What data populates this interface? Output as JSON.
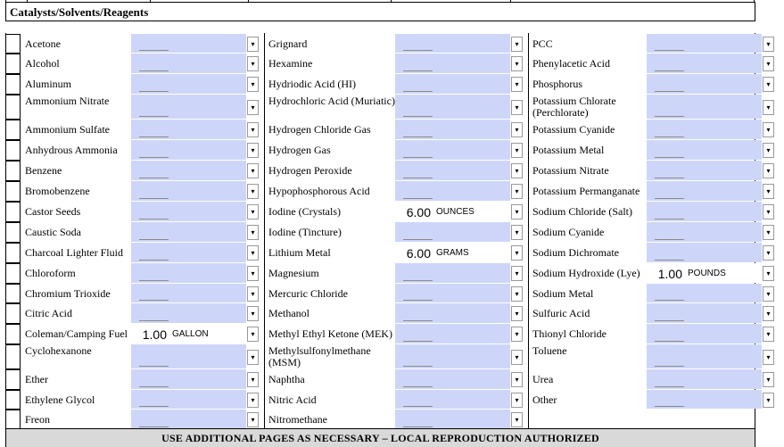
{
  "section": {
    "title": "Catalysts/Solvents/Reagents"
  },
  "footer": {
    "text": "USE ADDITIONAL PAGES AS NECESSARY – LOCAL REPRODUCTION AUTHORIZED"
  },
  "icons": {
    "dropdown": "chevron-down-icon",
    "dropdown_glyph": "▾"
  },
  "colors": {
    "field_fill": "#cdd6f8",
    "footer_fill": "#d9d9d9"
  },
  "columns": [
    {
      "items": [
        {
          "name": "Acetone"
        },
        {
          "name": "Alcohol"
        },
        {
          "name": "Aluminum"
        },
        {
          "name": "Ammonium Nitrate"
        },
        {
          "name": "Ammonium Sulfate"
        },
        {
          "name": "Anhydrous Ammonia"
        },
        {
          "name": "Benzene"
        },
        {
          "name": "Bromobenzene"
        },
        {
          "name": "Castor Seeds"
        },
        {
          "name": "Caustic Soda"
        },
        {
          "name": "Charcoal Lighter Fluid"
        },
        {
          "name": "Chloroform"
        },
        {
          "name": "Chromium Trioxide"
        },
        {
          "name": "Citric Acid"
        },
        {
          "name": "Coleman/Camping Fuel",
          "qty": "1.00",
          "unit": "GALLON"
        },
        {
          "name": "Cyclohexanone"
        },
        {
          "name": "Ether"
        },
        {
          "name": "Ethylene Glycol"
        },
        {
          "name": "Freon"
        }
      ]
    },
    {
      "items": [
        {
          "name": "Grignard"
        },
        {
          "name": "Hexamine"
        },
        {
          "name": "Hydriodic Acid (HI)"
        },
        {
          "name": "Hydrochloric Acid (Muriatic)"
        },
        {
          "name": "Hydrogen Chloride Gas"
        },
        {
          "name": "Hydrogen Gas"
        },
        {
          "name": "Hydrogen Peroxide"
        },
        {
          "name": "Hypophosphorous Acid"
        },
        {
          "name": "Iodine (Crystals)",
          "qty": "6.00",
          "unit": "OUNCES"
        },
        {
          "name": "Iodine (Tincture)"
        },
        {
          "name": "Lithium Metal",
          "qty": "6.00",
          "unit": "GRAMS"
        },
        {
          "name": "Magnesium"
        },
        {
          "name": "Mercuric Chloride"
        },
        {
          "name": "Methanol"
        },
        {
          "name": "Methyl Ethyl Ketone (MEK)"
        },
        {
          "name": "Methylsulfonylmethane (MSM)"
        },
        {
          "name": "Naphtha"
        },
        {
          "name": "Nitric Acid"
        },
        {
          "name": "Nitromethane"
        }
      ]
    },
    {
      "items": [
        {
          "name": "PCC"
        },
        {
          "name": "Phenylacetic Acid"
        },
        {
          "name": "Phosphorus"
        },
        {
          "name": "Potassium Chlorate (Perchlorate)"
        },
        {
          "name": "Potassium Cyanide"
        },
        {
          "name": " Potassium Metal"
        },
        {
          "name": "Potassium Nitrate"
        },
        {
          "name": "Potassium Permanganate"
        },
        {
          "name": "Sodium Chloride (Salt)"
        },
        {
          "name": "Sodium Cyanide"
        },
        {
          "name": "Sodium Dichromate"
        },
        {
          "name": "Sodium Hydroxide (Lye)",
          "qty": "1.00",
          "unit": "POUNDS"
        },
        {
          "name": "Sodium Metal"
        },
        {
          "name": "Sulfuric Acid"
        },
        {
          "name": "Thionyl Chloride"
        },
        {
          "name": "Toluene"
        },
        {
          "name": "Urea"
        },
        {
          "name": "Other"
        }
      ]
    }
  ]
}
